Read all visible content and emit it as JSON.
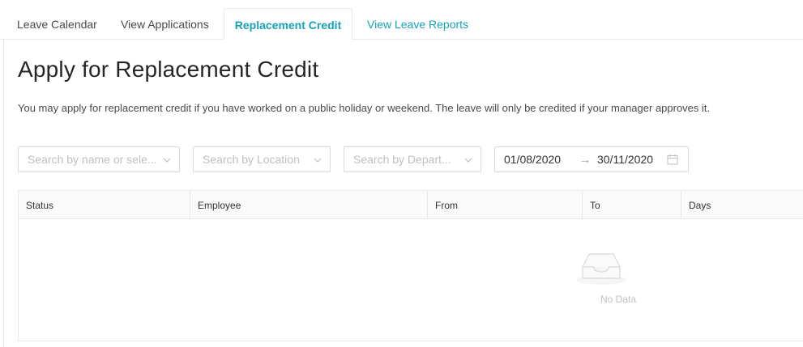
{
  "tabs": [
    {
      "label": "Leave Calendar"
    },
    {
      "label": "View Applications"
    },
    {
      "label": "Replacement Credit"
    },
    {
      "label": "View Leave Reports"
    }
  ],
  "page": {
    "title": "Apply for Replacement Credit",
    "description": "You may apply for replacement credit if you have worked on a public holiday or weekend. The leave will only be credited if your manager approves it."
  },
  "filters": {
    "employee_placeholder": "Search by name or sele...",
    "location_placeholder": "Search by Location",
    "department_placeholder": "Search by Depart...",
    "date_from": "01/08/2020",
    "date_arrow": "→",
    "date_to": "30/11/2020"
  },
  "table": {
    "columns": [
      "Status",
      "Employee",
      "From",
      "To",
      "Days"
    ],
    "empty_text": "No Data"
  },
  "colors": {
    "accent": "#17a2b8",
    "border": "#e8e8e8",
    "placeholder": "#bfbfbf"
  }
}
